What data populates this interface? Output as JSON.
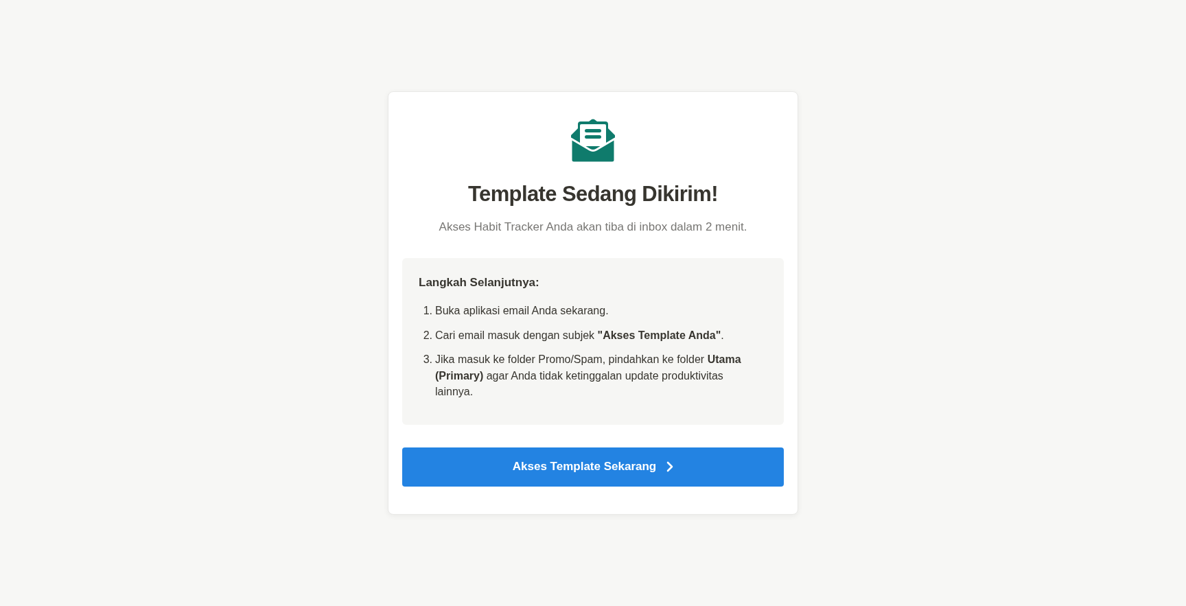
{
  "title": "Template Sedang Dikirim!",
  "subtitle": "Akses Habit Tracker Anda akan tiba di inbox dalam 2 menit.",
  "next_steps": {
    "heading": "Langkah Selanjutnya:",
    "items": [
      {
        "number": "1.",
        "text": "Buka aplikasi email Anda sekarang."
      },
      {
        "number": "2.",
        "text": "Cari email masuk dengan subjek **\"Akses Template Anda\"**."
      },
      {
        "number": "3.",
        "text": "Jika masuk ke folder Promo/Spam, pindahkan ke folder **Utama (Primary)** agar Anda tidak ketinggalan update produktivitas lainnya."
      }
    ]
  },
  "button": {
    "label": "Akses Template Sekarang"
  }
}
